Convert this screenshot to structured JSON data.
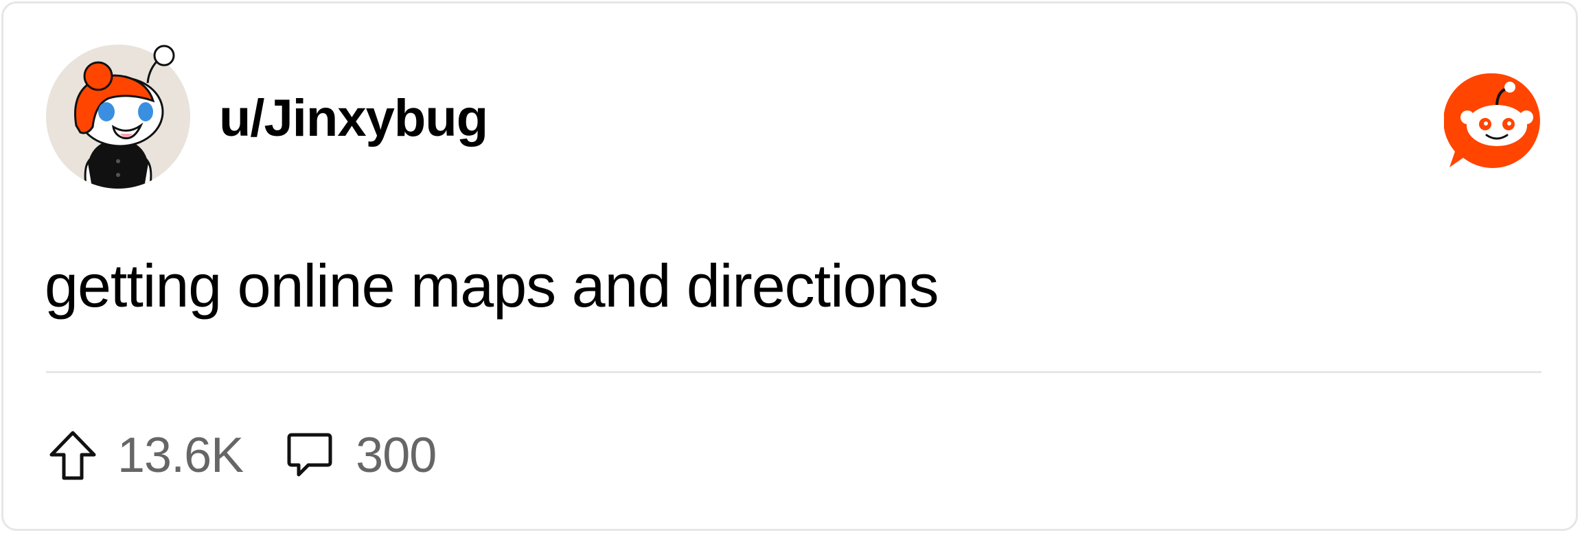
{
  "post": {
    "username": "u/Jinxybug",
    "title": "getting online maps and directions"
  },
  "stats": {
    "upvotes": "13.6K",
    "comments": "300"
  },
  "icons": {
    "avatar": "snoo-avatar",
    "brand": "reddit-logo-icon",
    "upvote": "upvote-arrow-icon",
    "comment": "comment-bubble-icon"
  },
  "colors": {
    "brand": "#FF4500",
    "text": "#000000",
    "muted": "#666666",
    "border": "#E6E6E6",
    "avatar_bg": "#E9E3DC",
    "avatar_hair": "#FF4500",
    "avatar_eyes": "#3B8FE0"
  }
}
